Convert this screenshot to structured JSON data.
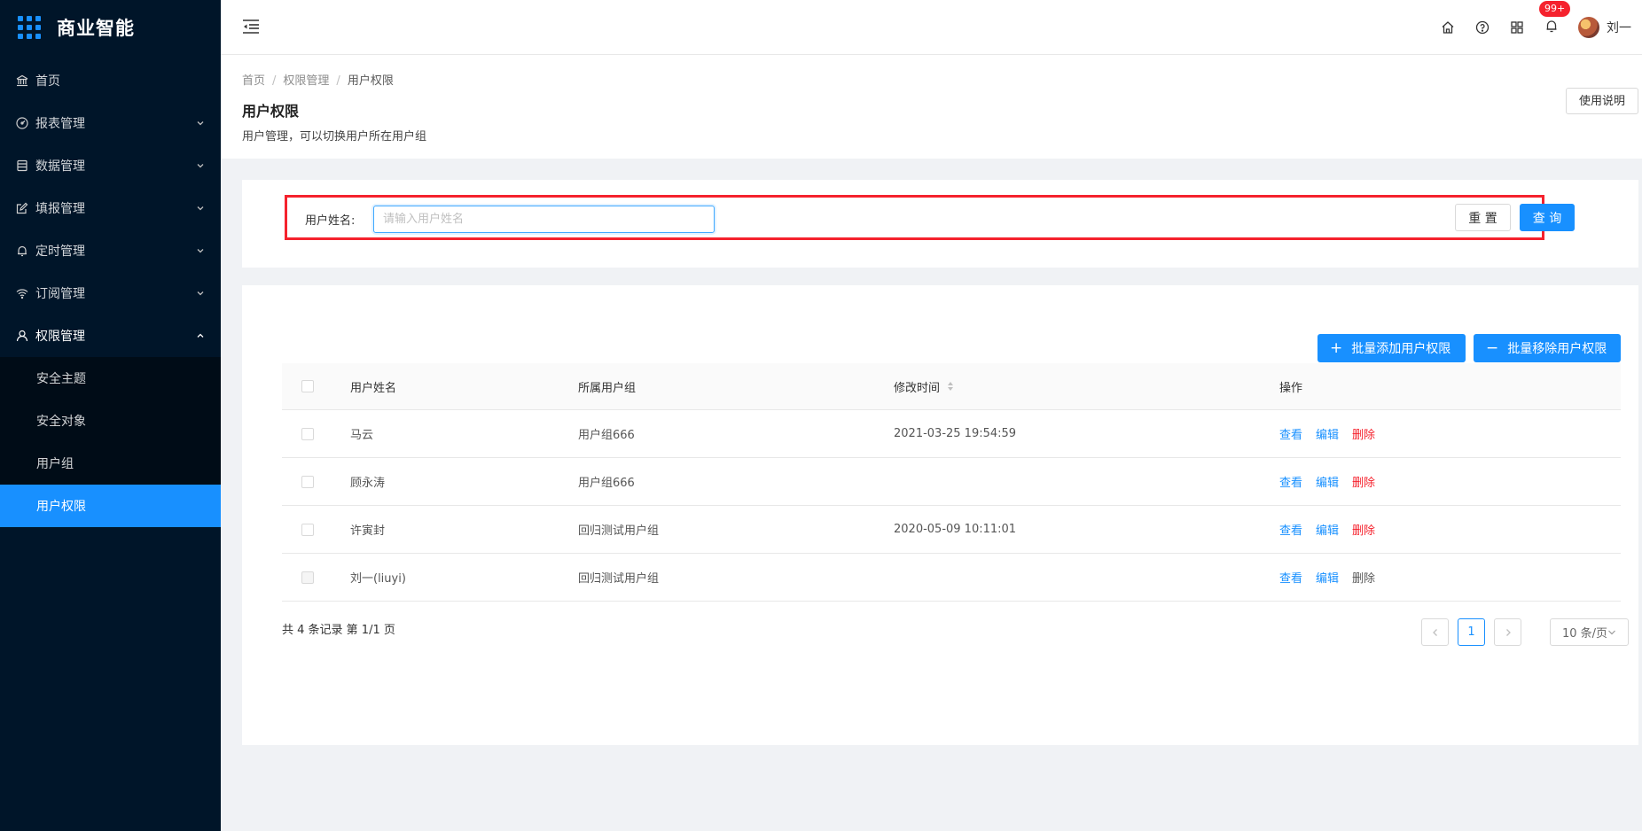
{
  "app": {
    "brand": "商业智能"
  },
  "sidebar": {
    "items": [
      {
        "label": "首页",
        "icon": "bank-icon"
      },
      {
        "label": "报表管理",
        "icon": "dashboard-icon"
      },
      {
        "label": "数据管理",
        "icon": "database-icon"
      },
      {
        "label": "填报管理",
        "icon": "edit-form-icon"
      },
      {
        "label": "定时管理",
        "icon": "bell-icon"
      },
      {
        "label": "订阅管理",
        "icon": "wifi-icon"
      },
      {
        "label": "权限管理",
        "icon": "user-icon"
      }
    ],
    "submenu": [
      {
        "label": "安全主题"
      },
      {
        "label": "安全对象"
      },
      {
        "label": "用户组"
      },
      {
        "label": "用户权限"
      }
    ],
    "active_item": "用户权限"
  },
  "header": {
    "notification_count": "99+",
    "user_name": "刘一"
  },
  "breadcrumb": [
    "首页",
    "权限管理",
    "用户权限"
  ],
  "page": {
    "title": "用户权限",
    "description": "用户管理，可以切换用户所在用户组",
    "help_button": "使用说明"
  },
  "search": {
    "label": "用户姓名:",
    "placeholder": "请输入用户姓名",
    "value": "",
    "reset_label": "重 置",
    "query_label": "查 询"
  },
  "actions": {
    "batch_add": "批量添加用户权限",
    "batch_remove": "批量移除用户权限"
  },
  "table": {
    "columns": [
      "用户姓名",
      "所属用户组",
      "修改时间",
      "操作"
    ],
    "rows": [
      {
        "name": "马云",
        "group": "用户组666",
        "time": "2021-03-25 19:54:59",
        "ops": [
          "查看",
          "编辑",
          "删除"
        ],
        "delete_disabled": false
      },
      {
        "name": "顾永涛",
        "group": "用户组666",
        "time": "",
        "ops": [
          "查看",
          "编辑",
          "删除"
        ],
        "delete_disabled": false
      },
      {
        "name": "许寅封",
        "group": "回归测试用户组",
        "time": "2020-05-09 10:11:01",
        "ops": [
          "查看",
          "编辑",
          "删除"
        ],
        "delete_disabled": false
      },
      {
        "name": "刘一(liuyi)",
        "group": "回归测试用户组",
        "time": "",
        "ops": [
          "查看",
          "编辑",
          "删除"
        ],
        "delete_disabled": true
      }
    ]
  },
  "pagination": {
    "total_text": "共 4 条记录 第 1/1 页",
    "current_page": "1",
    "page_size": "10 条/页"
  },
  "colors": {
    "primary": "#1890ff",
    "sidebar_bg": "#001529",
    "danger": "#f5222d"
  }
}
